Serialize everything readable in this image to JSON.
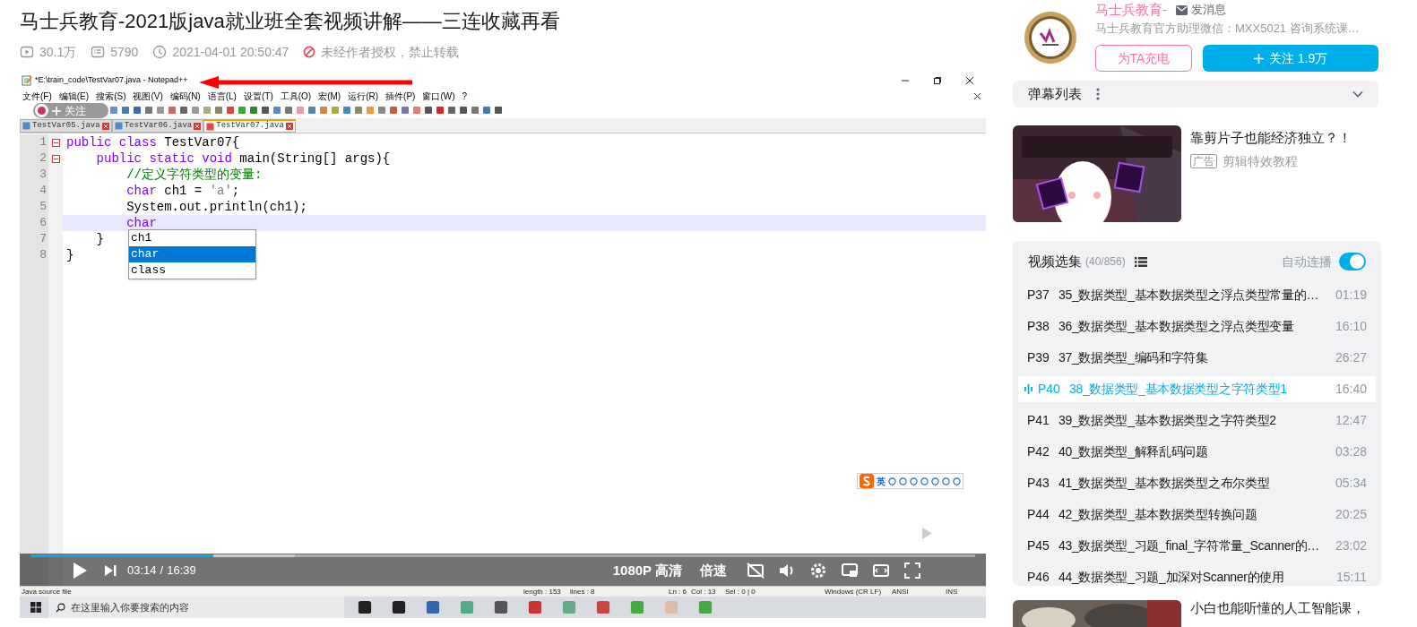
{
  "video_title": "马士兵教育-2021版java就业班全套视频讲解——三连收藏再看",
  "stats": {
    "views": "30.1万",
    "danmaku": "5790",
    "date": "2021-04-01 20:50:47",
    "notice": "未经作者授权，禁止转载"
  },
  "player": {
    "editor": {
      "window_title": "*E:\\train_code\\TestVar07.java - Notepad++",
      "menu": [
        "文件(F)",
        "编辑(E)",
        "搜索(S)",
        "视图(V)",
        "编码(N)",
        "语言(L)",
        "设置(T)",
        "工具(O)",
        "宏(M)",
        "运行(R)",
        "插件(P)",
        "窗口(W)",
        "?"
      ],
      "tabs": [
        {
          "label": "TestVar05.java",
          "selected": false
        },
        {
          "label": "TestVar06.java",
          "selected": false
        },
        {
          "label": "TestVar07.java",
          "selected": true
        }
      ],
      "lines": [
        {
          "number": "1",
          "fold": true,
          "current": false,
          "tokens": [
            {
              "text": "public class",
              "kind": "keyword"
            },
            {
              "text": " TestVar07{",
              "kind": "plain"
            }
          ]
        },
        {
          "number": "2",
          "fold": true,
          "current": false,
          "tokens": [
            {
              "text": "    public static void",
              "kind": "keyword"
            },
            {
              "text": " main(String[] args){",
              "kind": "plain"
            }
          ]
        },
        {
          "number": "3",
          "fold": false,
          "current": false,
          "tokens": [
            {
              "text": "        //定义字符类型的变量:",
              "kind": "comment"
            }
          ]
        },
        {
          "number": "4",
          "fold": false,
          "current": false,
          "tokens": [
            {
              "text": "        char",
              "kind": "type"
            },
            {
              "text": " ch1 = ",
              "kind": "plain"
            },
            {
              "text": "'a'",
              "kind": "string"
            },
            {
              "text": ";",
              "kind": "plain"
            }
          ]
        },
        {
          "number": "5",
          "fold": false,
          "current": false,
          "tokens": [
            {
              "text": "        System.out.println(ch1);",
              "kind": "plain"
            }
          ]
        },
        {
          "number": "6",
          "fold": false,
          "current": true,
          "tokens": [
            {
              "text": "        char",
              "kind": "type"
            }
          ]
        },
        {
          "number": "7",
          "fold": false,
          "current": false,
          "tokens": [
            {
              "text": "    }",
              "kind": "plain"
            }
          ]
        },
        {
          "number": "8",
          "fold": false,
          "current": false,
          "tokens": [
            {
              "text": "}",
              "kind": "plain"
            }
          ]
        }
      ],
      "autocomplete": [
        {
          "label": "ch1",
          "selected": false
        },
        {
          "label": "char",
          "selected": true
        },
        {
          "label": "class",
          "selected": false
        }
      ],
      "status_bar": {
        "file_type": "Java source file",
        "length": "length : 153",
        "lines": "lines : 8",
        "line": "Ln : 6",
        "column": "Col : 13",
        "selection": "Sel : 0 | 0",
        "eol": "Windows (CR LF)",
        "encoding": "ANSI",
        "mode": "INS"
      }
    },
    "overlay_follow": "关注",
    "ime": "英",
    "taskbar": {
      "search_placeholder": "在这里输入你要搜索的内容"
    },
    "controls": {
      "level": 0.194,
      "current_time": "03:14",
      "separator": "/",
      "duration": "16:39",
      "quality": "1080P 高清",
      "speed": "倍速"
    }
  },
  "uploader": {
    "name": "马士兵教育-",
    "message": "发消息",
    "description": "马士兵教育官方助理微信：MXX5021 咨询系统课…",
    "charge": "为TA充电",
    "follow": "关注 1.9万"
  },
  "danmaku_list": {
    "title": "弹幕列表"
  },
  "ad": {
    "title": "靠剪片子也能经济独立？！",
    "tag": "广告",
    "subtitle": "剪辑特效教程"
  },
  "playlist": {
    "title": "视频选集",
    "count": "(40/856)",
    "autoplay_label": "自动连播",
    "autoplay": true,
    "items": [
      {
        "part": "P37",
        "title": "35_数据类型_基本数据类型之浮点类型常量的…",
        "duration": "01:19",
        "selected": false
      },
      {
        "part": "P38",
        "title": "36_数据类型_基本数据类型之浮点类型变量",
        "duration": "16:10",
        "selected": false
      },
      {
        "part": "P39",
        "title": "37_数据类型_编码和字符集",
        "duration": "26:27",
        "selected": false
      },
      {
        "part": "P40",
        "title": "38_数据类型_基本数据类型之字符类型1",
        "duration": "16:40",
        "selected": true
      },
      {
        "part": "P41",
        "title": "39_数据类型_基本数据类型之字符类型2",
        "duration": "12:47",
        "selected": false
      },
      {
        "part": "P42",
        "title": "40_数据类型_解释乱码问题",
        "duration": "03:28",
        "selected": false
      },
      {
        "part": "P43",
        "title": "41_数据类型_基本数据类型之布尔类型",
        "duration": "05:34",
        "selected": false
      },
      {
        "part": "P44",
        "title": "42_数据类型_基本数据类型转换问题",
        "duration": "20:25",
        "selected": false
      },
      {
        "part": "P45",
        "title": "43_数据类型_习题_final_字符常量_Scanner的…",
        "duration": "23:02",
        "selected": false
      },
      {
        "part": "P46",
        "title": "44_数据类型_习题_加深对Scanner的使用",
        "duration": "15:11",
        "selected": false
      }
    ]
  },
  "next_video": {
    "title": "小白也能听懂的人工智能课，"
  }
}
